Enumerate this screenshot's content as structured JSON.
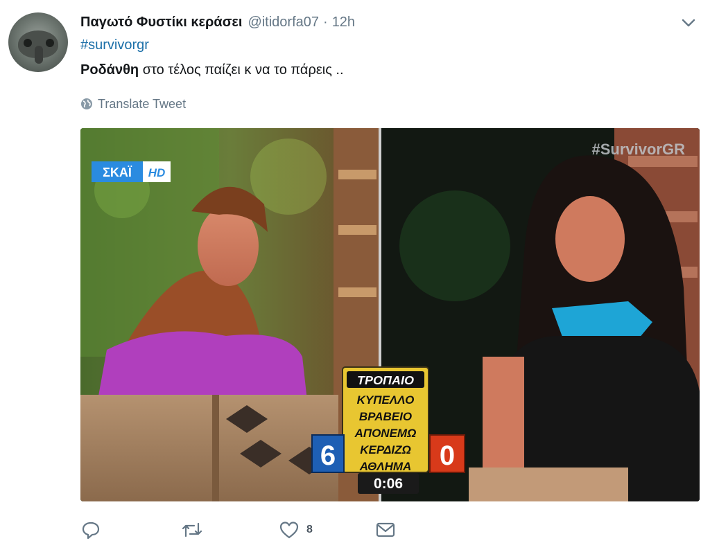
{
  "tweet": {
    "display_name": "Παγωτό Φυστίκι κεράσει",
    "handle": "@itidorfa07",
    "separator": "·",
    "time": "12h",
    "hashtag": "#survivorgr",
    "text_bold": "Ροδάνθη",
    "text_rest": " στο τέλος παίζει κ να το πάρεις ..",
    "translate_label": "Translate Tweet"
  },
  "media": {
    "channel_logo": "ΣΚΑΪ",
    "channel_hd": "HD",
    "show_tag": "#SurvivorGR",
    "words_header": "ΤΡΟΠΑΙΟ",
    "words": [
      "ΚΥΠΕΛΛΟ",
      "ΒΡΑΒΕΙΟ",
      "ΑΠΟΝΕΜΩ",
      "ΚΕΡΔΙΖΩ",
      "ΑΘΛΗΜΑ"
    ],
    "score_left": "6",
    "score_right": "0",
    "timer": "0:06"
  },
  "actions": {
    "like_count": "8"
  },
  "icons": [
    "chevron-down-icon",
    "globe-icon",
    "reply-icon",
    "retweet-icon",
    "like-icon",
    "message-icon"
  ],
  "colors": {
    "link": "#1b6fa8",
    "muted": "#657786",
    "score_blue": "#1e5fb4",
    "score_red": "#d83a1a",
    "word_panel": "#e8c631"
  }
}
